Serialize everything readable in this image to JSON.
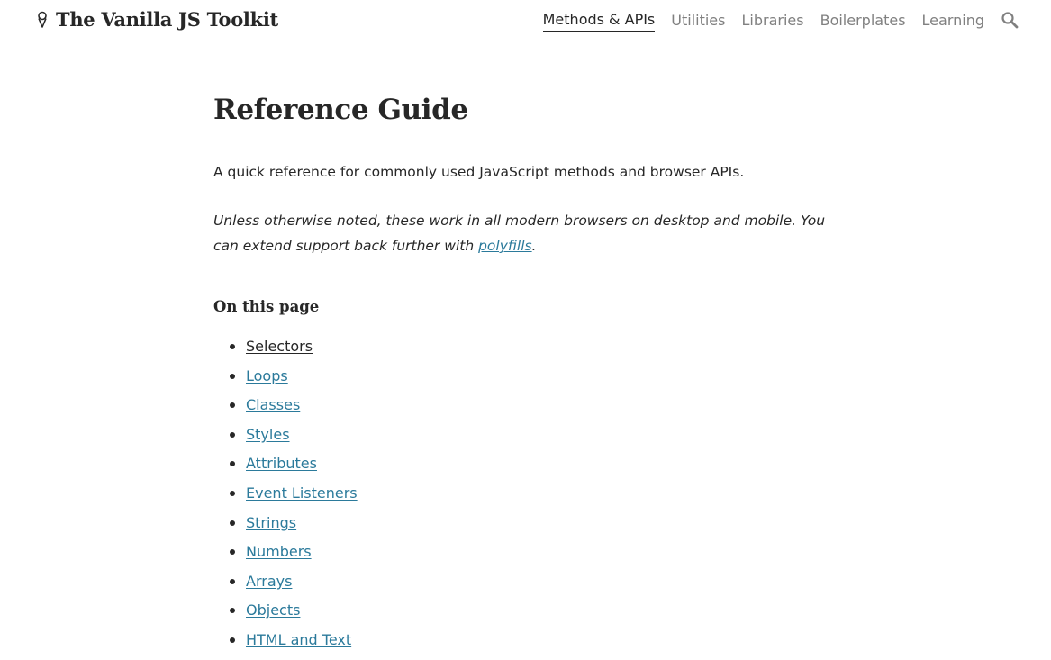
{
  "header": {
    "brand": "The Vanilla JS Toolkit",
    "brand_icon": "ice-cream-cone-icon",
    "nav": [
      {
        "label": "Methods & APIs",
        "active": true
      },
      {
        "label": "Utilities",
        "active": false
      },
      {
        "label": "Libraries",
        "active": false
      },
      {
        "label": "Boilerplates",
        "active": false
      },
      {
        "label": "Learning",
        "active": false
      }
    ],
    "search_icon": "search-icon"
  },
  "main": {
    "title": "Reference Guide",
    "lead": "A quick reference for commonly used JavaScript methods and browser APIs.",
    "note_before": "Unless otherwise noted, these work in all modern browsers on desktop and mobile. You can extend support back further with ",
    "note_link": "polyfills",
    "note_after": ".",
    "toc_heading": "On this page",
    "toc": [
      "Selectors",
      "Loops",
      "Classes",
      "Styles",
      "Attributes",
      "Event Listeners",
      "Strings",
      "Numbers",
      "Arrays",
      "Objects",
      "HTML and Text"
    ]
  },
  "colors": {
    "text": "#272727",
    "muted_nav": "#808080",
    "link": "#2b7a9b"
  }
}
